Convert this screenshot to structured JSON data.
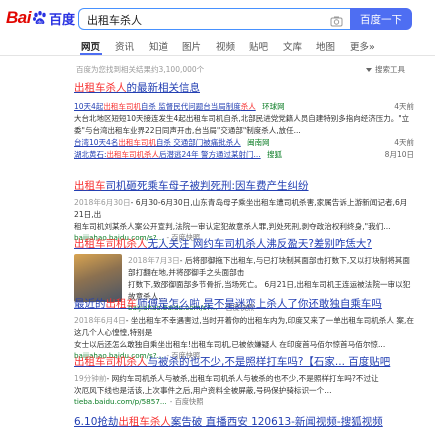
{
  "header": {
    "logo_bai": "Bai",
    "logo_du": "百度",
    "query": "出租车杀人",
    "search_button": "百度一下",
    "camera_icon": "camera-icon"
  },
  "tabs": [
    "网页",
    "资讯",
    "知道",
    "图片",
    "视频",
    "贴吧",
    "文库",
    "地图",
    "更多»"
  ],
  "active_tab": "网页",
  "stats": "百度为您找到相关结果约3,100,000个",
  "tools": "搜索工具",
  "news": {
    "title_pre": "出租车杀人",
    "title_post": "的最新相关信息",
    "items": [
      {
        "pre": "10天4起",
        "hl": "出租车司机",
        "mid": "自杀 监督民代问题台当局制度",
        "hl2": "杀人",
        "src": "环球网",
        "time": "4天前"
      },
      {
        "summary": "大台北地区短短10天接连发生4起出租车司机自杀,北部民进党党籍人员自建特别多指向经济压力。\"立"
      },
      {
        "summary": "委\"与台湾出租车业界22日同声开击,台当局\"交通部\"制度杀人,放任..."
      },
      {
        "pre": "台湾10天4名",
        "hl": "出租车司机",
        "mid": "自杀 交通部门被痛批杀人",
        "src": "闽南网",
        "time": "4天前"
      },
      {
        "pre": "湖北黄石:",
        "hl": "出租车司机杀人",
        "mid": "后潜逃24年 警方通过某射门...",
        "src": "搜狐",
        "time": "8月10日"
      }
    ]
  },
  "results": [
    {
      "title_pre": "",
      "title_hl": "出租车",
      "title_post": "司机砸死乘车母子被判死刑:因车费产生纠纷",
      "date": "2018年6月30日",
      "abstract_1": "- 6月30-6月30日,山东青岛母子乘坐出租车遭司机杀害,家属告诉上游新闻记者,6月21日,出",
      "abstract_2": "租车司机刘某杀人案公开宣判,法院一审认定犯故意杀人罪,判处死刑,剥夺政治权利终身,\"我们...",
      "url": "baijiahao.baidu.com/s?...",
      "cache": "- 百度快照",
      "thumb": false
    },
    {
      "title_pre": "",
      "title_hl": "出租车司机杀人",
      "title_post": "无人关注 网约车司机杀人沸反盈天?差别咋恁大?",
      "date": "2018年7月3日",
      "abstract_1": "- 后将邵御拖下出租车,与已打块制其面部击打数下,又以打块制将其面部打翻在地,并将邵御手之头面部击",
      "abstract_2": "打数下,致邵御面部多节骨折,当场死亡。 6月21日,出租车司机王连运被法院一审以犯故意杀人...",
      "url": "baijiahao.baidu.com/s?...",
      "cache": "- 百度快照",
      "thumb": true
    },
    {
      "title_pre": "最近的",
      "title_hl": "出租车",
      "title_post": "师傅是怎么啦,是不是迷恋上杀人了你还敢独自乘车吗",
      "date": "2018年6月4日",
      "abstract_1": "- 坐出租车不幸遇害过,当时开着你的出租车内为,印度又来了一单出租车司机杀人 案,在这几个人心惶惶,特别是",
      "abstract_2": "女士以后还怎么敢独自乘坐出租车!出租车司机,已被依嫌疑人 在印度首马佰尔惊首马佰尔惊...",
      "url": "baijiahao.baidu.com/s?...",
      "cache": "- 百度快照",
      "thumb": false
    },
    {
      "title_pre": "",
      "title_hl": "出租车司机杀人",
      "title_post": "与被杀的也不少,不是照样打车吗?【石家... 百度贴吧",
      "date": "19分钟前",
      "abstract_1": "- 网约车司机杀人与被杀,出租车司机杀人与被杀的也不少,不是照样打车吗?不过让",
      "abstract_2": "次厄风下线也是活该,上次事件之后,用户资料全被屏蔽,号码保护骑标识一个...",
      "url": "tieba.baidu.com/p/5857...",
      "cache": "- 百度快照",
      "thumb": false
    },
    {
      "title_pre": "6.10抢劫",
      "title_hl": "出租车杀人",
      "title_post": "案告破 直播西安 120613-新闻视频-搜狐视频",
      "thumb": false
    }
  ]
}
